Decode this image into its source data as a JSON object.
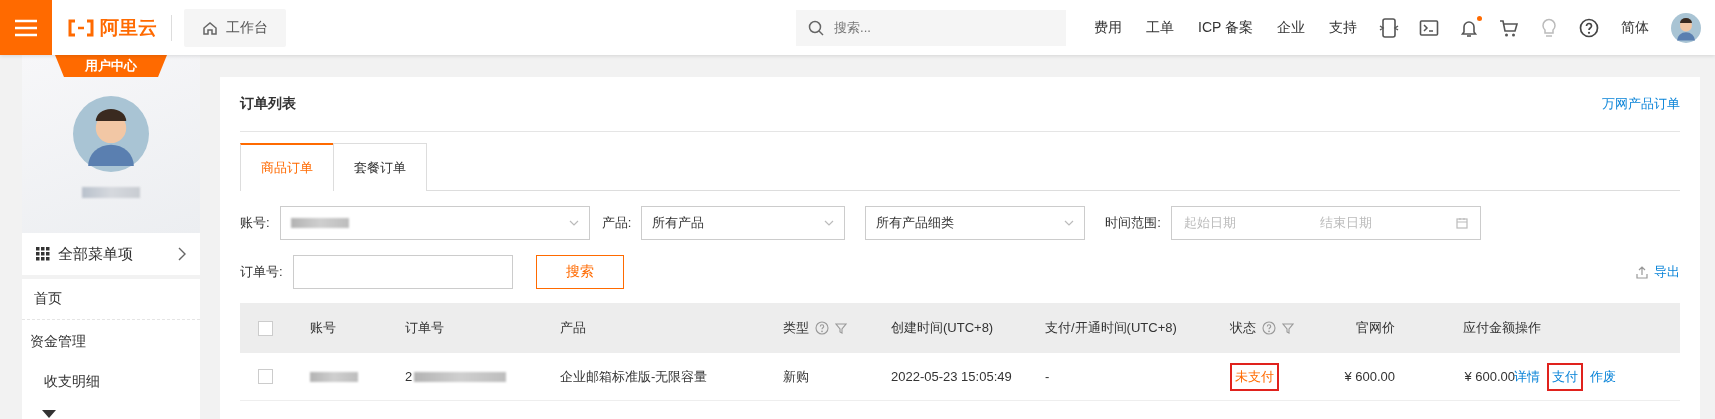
{
  "topbar": {
    "brand": "阿里云",
    "workbench": "工作台",
    "search": {
      "placeholder": "搜索..."
    },
    "links": [
      "费用",
      "工单",
      "ICP 备案",
      "企业",
      "支持"
    ],
    "notification_dot": true,
    "language": "简体"
  },
  "sidebar": {
    "banner": "用户中心",
    "all_menu": "全部菜单项",
    "items": [
      {
        "label": "首页"
      },
      {
        "label": "资金管理",
        "children": [
          {
            "label": "收支明细"
          }
        ]
      }
    ]
  },
  "panel": {
    "title": "订单列表",
    "link": "万网产品订单",
    "tabs": [
      {
        "label": "商品订单",
        "selected": true
      },
      {
        "label": "套餐订单",
        "selected": false
      }
    ],
    "filters": {
      "account_label": "账号:",
      "product_label": "产品:",
      "product": "所有产品",
      "subcategory": "所有产品细类",
      "time_label": "时间范围:",
      "start_placeholder": "起始日期",
      "end_placeholder": "结束日期",
      "order_label": "订单号:",
      "search_button": "搜索"
    },
    "export": "导出",
    "table": {
      "select_all_checked": false,
      "columns": [
        {
          "label": "账号",
          "kind": "plain"
        },
        {
          "label": "订单号",
          "kind": "plain"
        },
        {
          "label": "产品",
          "kind": "plain"
        },
        {
          "label": "类型",
          "kind": "filterable"
        },
        {
          "label": "创建时间(UTC+8)",
          "kind": "plain"
        },
        {
          "label": "支付/开通时间(UTC+8)",
          "kind": "plain"
        },
        {
          "label": "状态",
          "kind": "filterable"
        },
        {
          "label": "官网价",
          "kind": "plain"
        },
        {
          "label": "应付金额",
          "kind": "plain"
        },
        {
          "label": "操作",
          "kind": "plain"
        }
      ],
      "rows": [
        {
          "checked": false,
          "order_no": "2",
          "product": "企业邮箱标准版-无限容量",
          "type": "新购",
          "created": "2022-05-23 15:05:49",
          "paid": "-",
          "status": "未支付",
          "status_highlighted": true,
          "list_price": "¥ 600.00",
          "amount": "¥ 600.00",
          "actions": [
            {
              "label": "详情",
              "highlighted": false
            },
            {
              "label": "支付",
              "highlighted": true
            },
            {
              "label": "作废",
              "highlighted": false
            }
          ]
        }
      ]
    }
  }
}
